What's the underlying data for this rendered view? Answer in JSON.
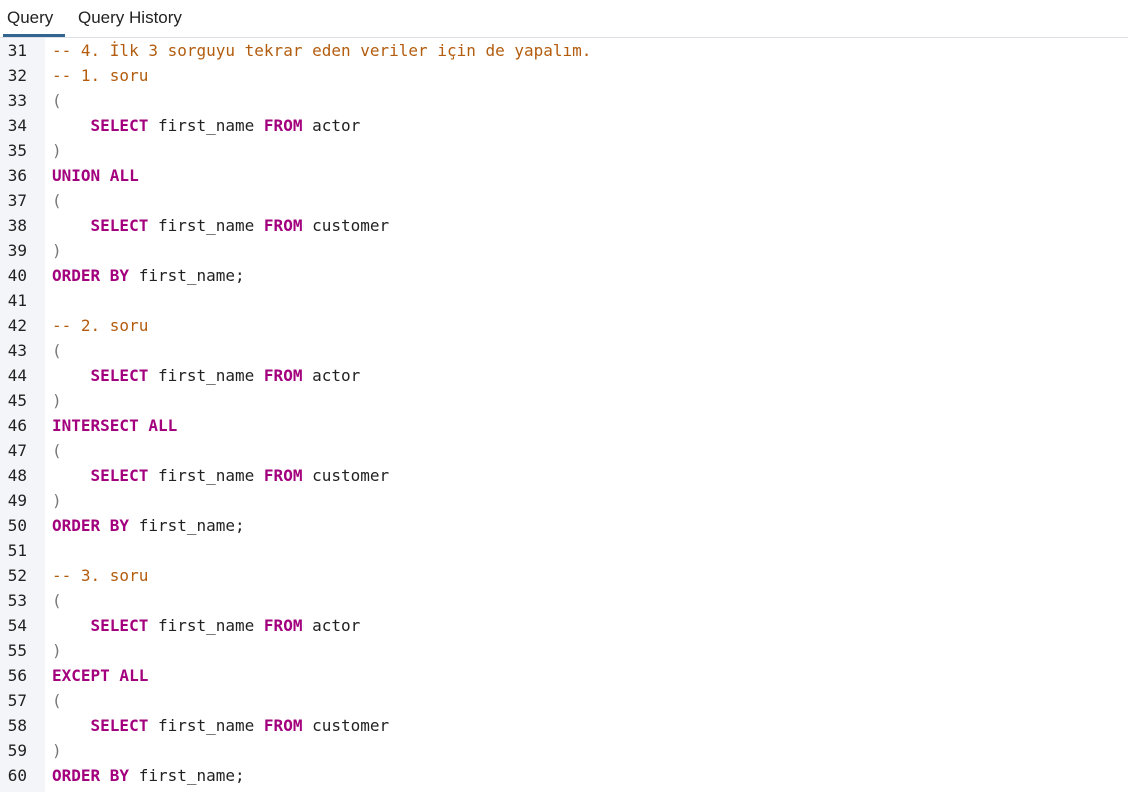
{
  "tabs": [
    {
      "label": "Query",
      "active": true
    },
    {
      "label": "Query History",
      "active": false
    }
  ],
  "colors": {
    "keyword": "#a3007e",
    "comment": "#b35c0e",
    "text": "#222222",
    "gutter_bg": "#f3f5f9",
    "active_tab_underline": "#326690"
  },
  "editor": {
    "lines": [
      {
        "no": "31",
        "tokens": [
          {
            "t": "cm",
            "v": "-- 4. İlk 3 sorguyu tekrar eden veriler için de yapalım."
          }
        ]
      },
      {
        "no": "32",
        "tokens": [
          {
            "t": "cm",
            "v": "-- 1. soru"
          }
        ]
      },
      {
        "no": "33",
        "tokens": [
          {
            "t": "br",
            "v": "("
          }
        ]
      },
      {
        "no": "34",
        "tokens": [
          {
            "t": "ws",
            "v": "    "
          },
          {
            "t": "kw",
            "v": "SELECT"
          },
          {
            "t": "id",
            "v": " first_name "
          },
          {
            "t": "kw",
            "v": "FROM"
          },
          {
            "t": "id",
            "v": " actor"
          }
        ]
      },
      {
        "no": "35",
        "tokens": [
          {
            "t": "br",
            "v": ")"
          }
        ]
      },
      {
        "no": "36",
        "tokens": [
          {
            "t": "kw",
            "v": "UNION ALL"
          }
        ]
      },
      {
        "no": "37",
        "tokens": [
          {
            "t": "br",
            "v": "("
          }
        ]
      },
      {
        "no": "38",
        "tokens": [
          {
            "t": "ws",
            "v": "    "
          },
          {
            "t": "kw",
            "v": "SELECT"
          },
          {
            "t": "id",
            "v": " first_name "
          },
          {
            "t": "kw",
            "v": "FROM"
          },
          {
            "t": "id",
            "v": " customer"
          }
        ]
      },
      {
        "no": "39",
        "tokens": [
          {
            "t": "br",
            "v": ")"
          }
        ]
      },
      {
        "no": "40",
        "tokens": [
          {
            "t": "kw",
            "v": "ORDER BY"
          },
          {
            "t": "id",
            "v": " first_name;"
          }
        ]
      },
      {
        "no": "41",
        "tokens": []
      },
      {
        "no": "42",
        "tokens": [
          {
            "t": "cm",
            "v": "-- 2. soru"
          }
        ]
      },
      {
        "no": "43",
        "tokens": [
          {
            "t": "br",
            "v": "("
          }
        ]
      },
      {
        "no": "44",
        "tokens": [
          {
            "t": "ws",
            "v": "    "
          },
          {
            "t": "kw",
            "v": "SELECT"
          },
          {
            "t": "id",
            "v": " first_name "
          },
          {
            "t": "kw",
            "v": "FROM"
          },
          {
            "t": "id",
            "v": " actor"
          }
        ]
      },
      {
        "no": "45",
        "tokens": [
          {
            "t": "br",
            "v": ")"
          }
        ]
      },
      {
        "no": "46",
        "tokens": [
          {
            "t": "kw",
            "v": "INTERSECT ALL"
          }
        ]
      },
      {
        "no": "47",
        "tokens": [
          {
            "t": "br",
            "v": "("
          }
        ]
      },
      {
        "no": "48",
        "tokens": [
          {
            "t": "ws",
            "v": "    "
          },
          {
            "t": "kw",
            "v": "SELECT"
          },
          {
            "t": "id",
            "v": " first_name "
          },
          {
            "t": "kw",
            "v": "FROM"
          },
          {
            "t": "id",
            "v": " customer"
          }
        ]
      },
      {
        "no": "49",
        "tokens": [
          {
            "t": "br",
            "v": ")"
          }
        ]
      },
      {
        "no": "50",
        "tokens": [
          {
            "t": "kw",
            "v": "ORDER BY"
          },
          {
            "t": "id",
            "v": " first_name;"
          }
        ]
      },
      {
        "no": "51",
        "tokens": []
      },
      {
        "no": "52",
        "tokens": [
          {
            "t": "cm",
            "v": "-- 3. soru"
          }
        ]
      },
      {
        "no": "53",
        "tokens": [
          {
            "t": "br",
            "v": "("
          }
        ]
      },
      {
        "no": "54",
        "tokens": [
          {
            "t": "ws",
            "v": "    "
          },
          {
            "t": "kw",
            "v": "SELECT"
          },
          {
            "t": "id",
            "v": " first_name "
          },
          {
            "t": "kw",
            "v": "FROM"
          },
          {
            "t": "id",
            "v": " actor"
          }
        ]
      },
      {
        "no": "55",
        "tokens": [
          {
            "t": "br",
            "v": ")"
          }
        ]
      },
      {
        "no": "56",
        "tokens": [
          {
            "t": "kw",
            "v": "EXCEPT ALL"
          }
        ]
      },
      {
        "no": "57",
        "tokens": [
          {
            "t": "br",
            "v": "("
          }
        ]
      },
      {
        "no": "58",
        "tokens": [
          {
            "t": "ws",
            "v": "    "
          },
          {
            "t": "kw",
            "v": "SELECT"
          },
          {
            "t": "id",
            "v": " first_name "
          },
          {
            "t": "kw",
            "v": "FROM"
          },
          {
            "t": "id",
            "v": " customer"
          }
        ]
      },
      {
        "no": "59",
        "tokens": [
          {
            "t": "br",
            "v": ")"
          }
        ]
      },
      {
        "no": "60",
        "tokens": [
          {
            "t": "kw",
            "v": "ORDER BY"
          },
          {
            "t": "id",
            "v": " first_name;"
          }
        ]
      }
    ]
  }
}
